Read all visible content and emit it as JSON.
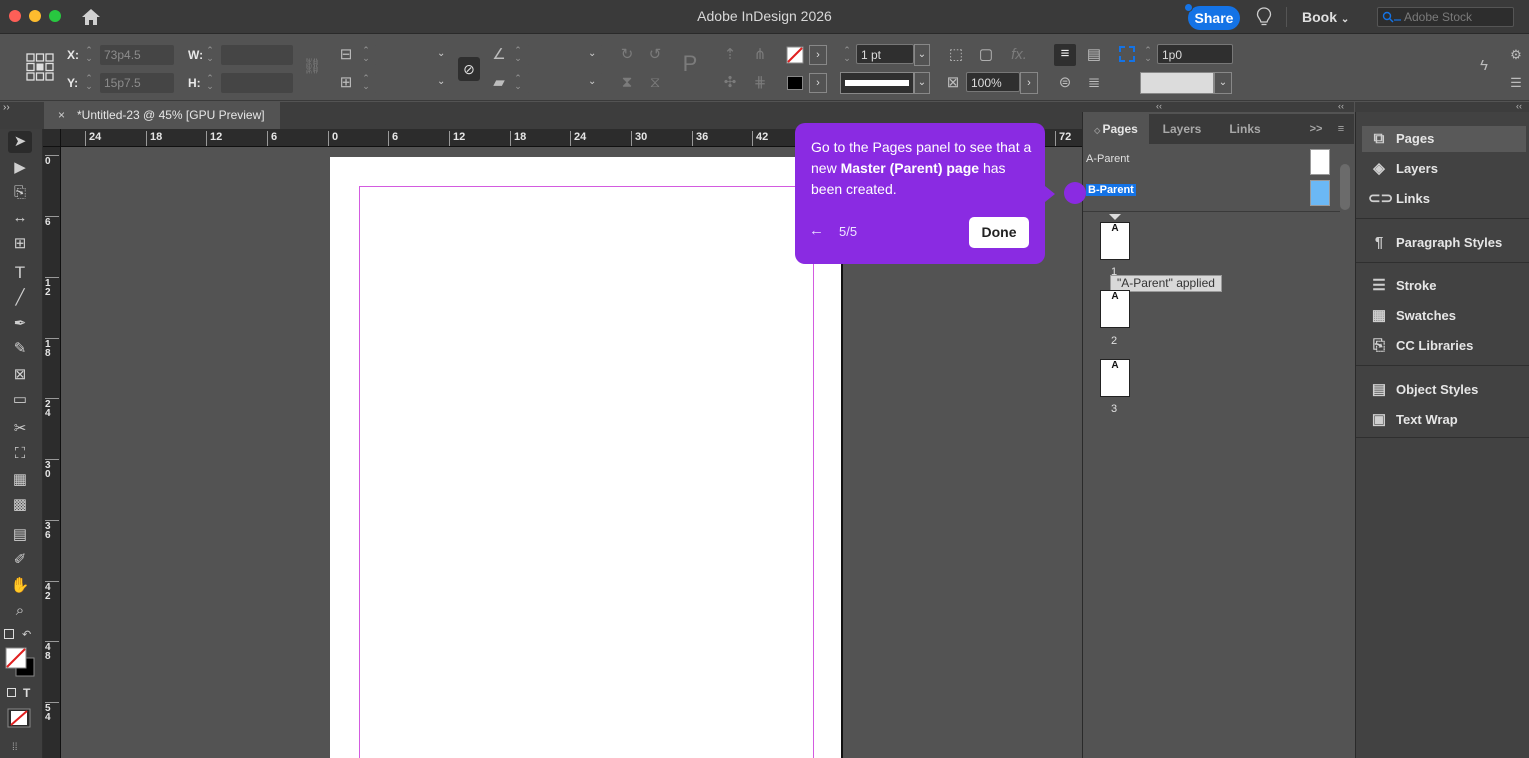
{
  "window": {
    "title": "Adobe InDesign 2026",
    "share_label": "Share",
    "workspace_label": "Book",
    "stock_placeholder": "Adobe Stock"
  },
  "control_bar": {
    "x_label": "X:",
    "x_value": "73p4.5",
    "y_label": "Y:",
    "y_value": "15p7.5",
    "w_label": "W:",
    "h_label": "H:",
    "stroke_weight": "1 pt",
    "zoom": "100%",
    "spacing": "1p0"
  },
  "tab": {
    "title": "*Untitled-23 @ 45% [GPU Preview]",
    "close": "×"
  },
  "rulers": {
    "horizontal": [
      "24",
      "18",
      "12",
      "6",
      "0",
      "6",
      "12",
      "18",
      "24",
      "30",
      "36",
      "42",
      "72"
    ],
    "vertical": [
      "0",
      "6",
      "1\n2",
      "1\n8",
      "2\n4",
      "3\n0",
      "3\n6",
      "4\n2",
      "4\n8",
      "5\n4"
    ]
  },
  "pages_panel": {
    "tabs": [
      "Pages",
      "Layers",
      "Links"
    ],
    "parents": [
      "A-Parent",
      "B-Parent"
    ],
    "pages": [
      {
        "prefix": "A",
        "number": "1"
      },
      {
        "prefix": "A",
        "number": "2"
      },
      {
        "prefix": "A",
        "number": "3"
      }
    ],
    "tooltip": "\"A-Parent\" applied"
  },
  "dock": {
    "items": [
      "Pages",
      "Layers",
      "Links",
      "Paragraph Styles",
      "Stroke",
      "Swatches",
      "CC Libraries",
      "Object Styles",
      "Text Wrap"
    ]
  },
  "coach": {
    "text_prefix": "Go to the Pages panel to see that a new ",
    "text_bold": "Master (Parent) page",
    "text_suffix": " has been created.",
    "step": "5/5",
    "done_label": "Done",
    "accent": "#8a2be2"
  },
  "colors": {
    "accent_blue": "#1473e6",
    "margin_guide": "#d35be0",
    "b_parent_fill": "#6bb8f5"
  }
}
